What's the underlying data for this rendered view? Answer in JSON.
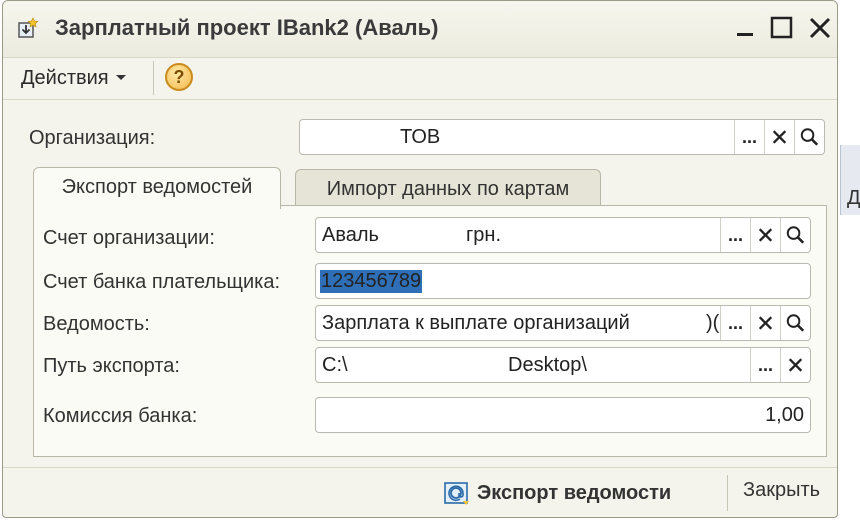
{
  "window": {
    "title": "Зарплатный проект IBank2 (Аваль)"
  },
  "toolbar": {
    "actions_label": "Действия",
    "help_label": "?"
  },
  "form": {
    "organization": {
      "label": "Организация:",
      "value": "ТОВ"
    },
    "tabs": [
      {
        "label": "Экспорт ведомостей",
        "active": true
      },
      {
        "label": "Импорт данных по картам",
        "active": false
      }
    ],
    "account": {
      "label": "Счет организации:",
      "value_left": "Аваль",
      "value_right": "грн."
    },
    "payer_account": {
      "label": "Счет банка плательщика:",
      "value": "123456789"
    },
    "statement": {
      "label": "Ведомость:",
      "value": "Зарплата к выплате организаций",
      "tail": ")("
    },
    "export_path": {
      "label": "Путь экспорта:",
      "value_left": "C:\\",
      "value_right": "Desktop\\"
    },
    "commission": {
      "label": "Комиссия банка:",
      "value": "1,00"
    }
  },
  "buttons": {
    "dots": "...",
    "export_label": "Экспорт ведомости",
    "close_label": "Закрыть"
  },
  "colors": {
    "selection": "#2f6fb7",
    "help_fill": "#f3b84a",
    "window_bg": "#f4f4ec"
  }
}
